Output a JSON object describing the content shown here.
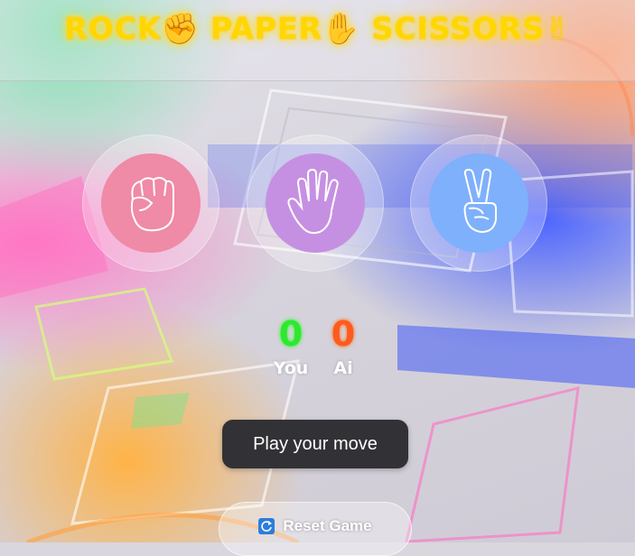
{
  "title": "ROCK✊ PAPER✋ SCISSORS✌",
  "choices": [
    {
      "name": "rock",
      "icon": "fist-icon",
      "color": "#ef8aa7"
    },
    {
      "name": "paper",
      "icon": "open-hand-icon",
      "color": "#c690e2"
    },
    {
      "name": "scissors",
      "icon": "victory-hand-icon",
      "color": "#7fb0fb"
    }
  ],
  "score": {
    "you": {
      "value": "0",
      "label": "You",
      "color": "#2ee82e"
    },
    "ai": {
      "value": "0",
      "label": "Ai",
      "color": "#ff5a1f"
    }
  },
  "message": "Play your move",
  "reset": {
    "label": "Reset Game",
    "icon": "refresh-icon"
  }
}
